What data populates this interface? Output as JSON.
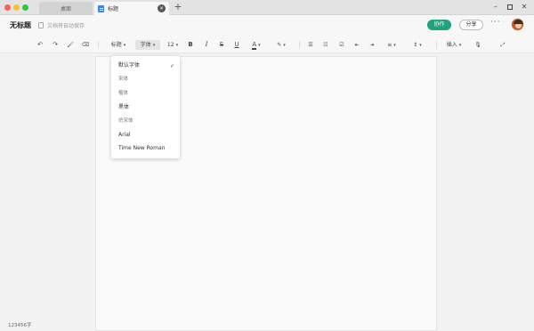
{
  "tabs": {
    "inactive_label": "桌面",
    "active_label": "标题",
    "close_glyph": "×",
    "add_glyph": "+"
  },
  "window": {
    "minimize_glyph": "–",
    "close_glyph": "✕",
    "controls_color": "#444444"
  },
  "header": {
    "doc_title": "无标题",
    "save_status": "文档将自动保存",
    "collab_label": "协作",
    "share_label": "分享",
    "more_glyph": "···",
    "accent_color": "#1fa37d"
  },
  "toolbar": {
    "undo": "↶",
    "redo": "↷",
    "format_painter": "🖌",
    "clear_format": "⌫",
    "heading_label": "标题",
    "font_label": "字体",
    "font_size": "12",
    "bold": "B",
    "italic": "I",
    "strike": "S",
    "underline": "U",
    "font_color": "A",
    "highlight": "✎",
    "bullet_list": "☰",
    "numbered_list": "☷",
    "checklist": "☑",
    "outdent": "⇤",
    "indent": "⇥",
    "align": "≡",
    "line_height": "↕",
    "insert_label": "插入",
    "mic": "🎙",
    "expand": "⤢",
    "dropdown_caret": "▾"
  },
  "font_menu": {
    "items": [
      "默认字体",
      "宋体",
      "楷体",
      "黑体",
      "仿宋体",
      "Arial",
      "Time New Roman"
    ],
    "selected_index": 0,
    "check_glyph": "✓"
  },
  "status": {
    "word_count": "123456字"
  }
}
